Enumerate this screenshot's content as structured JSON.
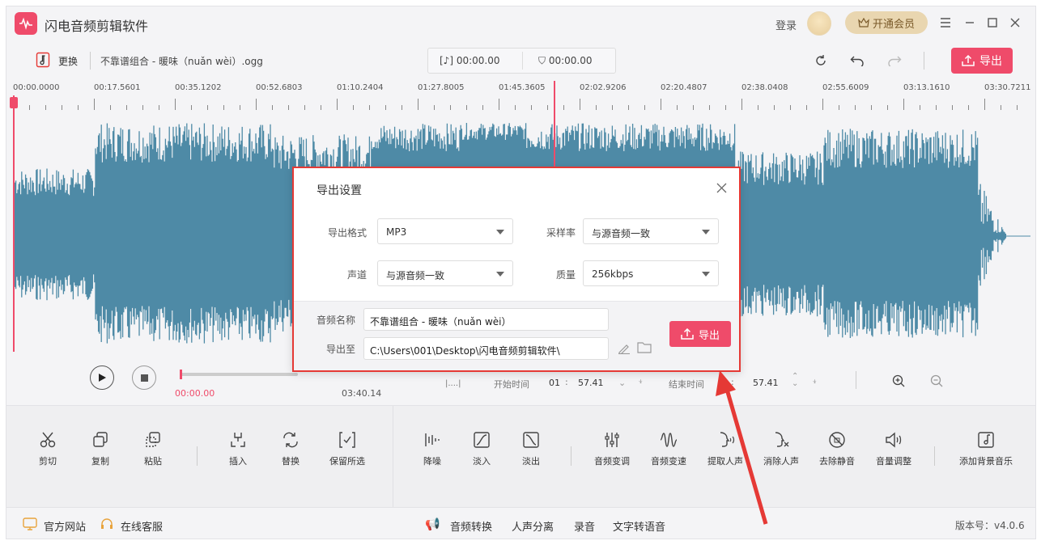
{
  "app": {
    "title": "闪电音频剪辑软件",
    "login": "登录",
    "vip": "开通会员"
  },
  "toolbar": {
    "replace": "更换",
    "filename": "不靠谱组合 - 暖味（nuǎn wèi）.ogg",
    "time_a": "00:00.00",
    "time_b": "00:00.00",
    "export": "导出"
  },
  "ruler": {
    "labels": [
      "00:00.0000",
      "00:17.5601",
      "00:35.1202",
      "00:52.6803",
      "01:10.2404",
      "01:27.8005",
      "01:45.3605",
      "02:02.9206",
      "02:20.4807",
      "02:38.0408",
      "02:55.6009",
      "03:13.1610",
      "03:30.7211"
    ]
  },
  "playback": {
    "current": "00:00.00",
    "total": "03:40.14",
    "start_label": "开始时间",
    "start_min": "01",
    "start_sec": "57.41",
    "end_label": "结束时间",
    "end_sec": "57.41"
  },
  "tools": [
    {
      "label": "剪切",
      "icon": "scissors-icon"
    },
    {
      "label": "复制",
      "icon": "copy-icon"
    },
    {
      "label": "粘贴",
      "icon": "paste-icon"
    },
    {
      "label": "插入",
      "icon": "insert-icon"
    },
    {
      "label": "替换",
      "icon": "replace-icon"
    },
    {
      "label": "保留所选",
      "icon": "keep-selection-icon"
    },
    {
      "label": "降噪",
      "icon": "denoise-icon"
    },
    {
      "label": "淡入",
      "icon": "fade-in-icon"
    },
    {
      "label": "淡出",
      "icon": "fade-out-icon"
    },
    {
      "label": "音频变调",
      "icon": "pitch-icon"
    },
    {
      "label": "音频变速",
      "icon": "speed-icon"
    },
    {
      "label": "提取人声",
      "icon": "extract-voice-icon"
    },
    {
      "label": "消除人声",
      "icon": "remove-voice-icon"
    },
    {
      "label": "去除静音",
      "icon": "remove-silence-icon"
    },
    {
      "label": "音量调整",
      "icon": "volume-icon"
    },
    {
      "label": "添加背景音乐",
      "icon": "music-note-icon"
    }
  ],
  "status": {
    "website": "官方网站",
    "service": "在线客服",
    "convert": "音频转换",
    "separate": "人声分离",
    "record": "录音",
    "tts": "文字转语音",
    "version": "版本号：v4.0.6"
  },
  "dialog": {
    "title": "导出设置",
    "format_label": "导出格式",
    "format_value": "MP3",
    "samplerate_label": "采样率",
    "samplerate_value": "与源音频一致",
    "channel_label": "声道",
    "channel_value": "与源音频一致",
    "quality_label": "质量",
    "quality_value": "256kbps",
    "name_label": "音频名称",
    "name_value": "不靠谱组合 - 暖味（nuǎn wèi）",
    "path_label": "导出至",
    "path_value": "C:\\Users\\001\\Desktop\\闪电音频剪辑软件\\",
    "export": "导出"
  },
  "colors": {
    "accent": "#ef4b6a",
    "wave": "#4e8aa6",
    "highlight": "#e53935"
  }
}
